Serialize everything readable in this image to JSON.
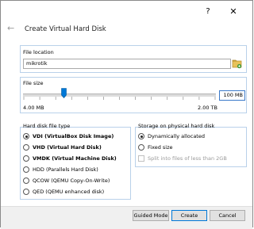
{
  "title_bar": {
    "help": "?",
    "close": "✕"
  },
  "page": {
    "title": "Create Virtual Hard Disk"
  },
  "file_location": {
    "label": "File location",
    "value": "mikrotik"
  },
  "file_size": {
    "label": "File size",
    "value": "100 MB",
    "min_label": "4.00 MB",
    "max_label": "2.00 TB",
    "slider_fraction": 0.21
  },
  "disk_type": {
    "label": "Hard disk file type",
    "selected_index": 0,
    "options": [
      "VDI (VirtualBox Disk Image)",
      "VHD (Virtual Hard Disk)",
      "VMDK (Virtual Machine Disk)",
      "HDD (Parallels Hard Disk)",
      "QCOW (QEMU Copy-On-Write)",
      "QED (QEMU enhanced disk)"
    ]
  },
  "storage": {
    "label": "Storage on physical hard disk",
    "options": [
      "Dynamically allocated",
      "Fixed size"
    ],
    "selected_index": 0,
    "split_label": "Split into files of less than 2GB"
  },
  "buttons": {
    "guided": "Guided Mode",
    "create": "Create",
    "cancel": "Cancel"
  },
  "icons": {
    "back": "back-arrow-icon",
    "folder": "folder-icon"
  }
}
